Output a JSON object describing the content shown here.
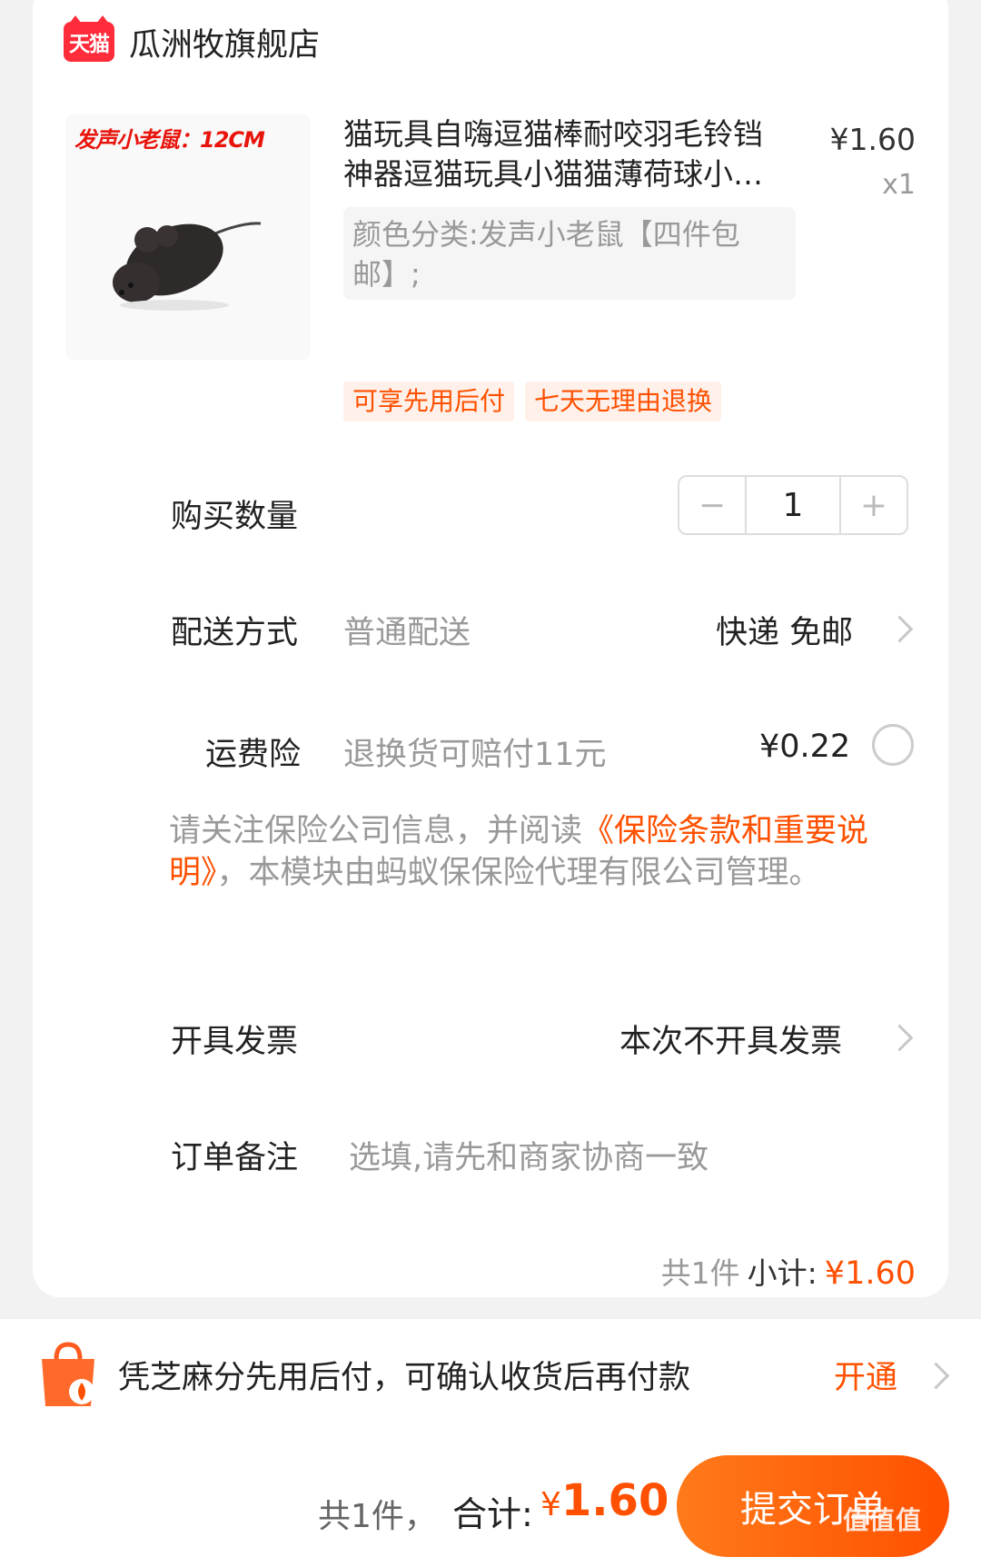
{
  "shop": {
    "badge": "天猫",
    "name": "瓜洲牧旗舰店"
  },
  "product": {
    "image_caption": "发声小老鼠：12CM",
    "title": "猫玩具自嗨逗猫棒耐咬羽毛铃铛神器逗猫玩具小猫猫薄荷球小猫咪用品",
    "unit_price": "¥1.60",
    "quantity_label": "x1",
    "sku": "颜色分类:发声小老鼠【四件包邮】;",
    "tags": [
      "可享先用后付",
      "七天无理由退换"
    ]
  },
  "quantity": {
    "label": "购买数量",
    "value": "1",
    "minus": "−",
    "plus": "+"
  },
  "delivery": {
    "label": "配送方式",
    "method": "普通配送",
    "value": "快递 免邮"
  },
  "insurance": {
    "label": "运费险",
    "desc": "退换货可赔付11元",
    "price": "¥0.22"
  },
  "notice": {
    "text_before": "请关注保险公司信息，并阅读",
    "link": "《保险条款和重要说明》",
    "text_after": "，本模块由蚂蚁保保险代理有限公司管理。"
  },
  "invoice": {
    "label": "开具发票",
    "value": "本次不开具发票"
  },
  "remark": {
    "label": "订单备注",
    "placeholder": "选填,请先和商家协商一致"
  },
  "subtotal": {
    "count": "共1件",
    "label": "小计:",
    "amount": "¥1.60"
  },
  "zhima": {
    "text": "凭芝麻分先用后付，可确认收货后再付款",
    "action": "开通"
  },
  "footer": {
    "count": "共1件，",
    "total_label": "合计:",
    "total_currency": "¥",
    "total_amount": "1.60",
    "submit": "提交订单"
  },
  "watermark": "值值值",
  "colors": {
    "accent": "#ff5000",
    "tmall_red": "#ff2c3c"
  }
}
